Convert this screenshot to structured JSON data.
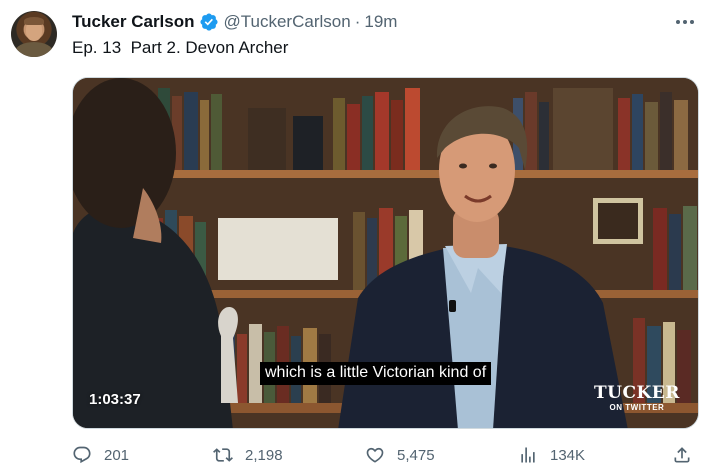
{
  "tweet": {
    "author": {
      "display_name": "Tucker Carlson",
      "verified": true,
      "handle": "@TuckerCarlson",
      "separator": "·",
      "time": "19m"
    },
    "text": "Ep. 13  Part 2. Devon Archer",
    "media": {
      "type": "video",
      "caption": "which is a little Victorian kind of",
      "duration": "1:03:37",
      "watermark_main": "TUCKER",
      "watermark_sub": "ON TWITTER"
    },
    "actions": {
      "replies": "201",
      "retweets": "2,198",
      "likes": "5,475",
      "views": "134K"
    }
  },
  "colors": {
    "text_primary": "#0f1419",
    "text_secondary": "#536471",
    "verified_blue": "#1d9bf0",
    "border": "#cfd9de"
  },
  "icons": {
    "verified": "verified-badge-icon",
    "more": "more-dots-icon",
    "reply": "reply-icon",
    "retweet": "retweet-icon",
    "like": "heart-icon",
    "views": "views-bars-icon",
    "share": "share-icon"
  }
}
